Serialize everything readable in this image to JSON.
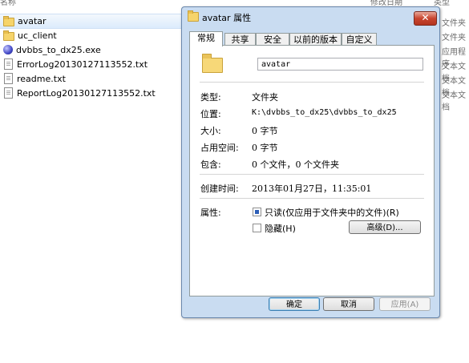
{
  "explorer": {
    "header": {
      "name_col": "名称",
      "date_col": "修改日期",
      "type_col": "类型"
    },
    "files": [
      {
        "name": "avatar",
        "icon": "folder-icon",
        "type": "文件夹",
        "selected": true
      },
      {
        "name": "uc_client",
        "icon": "folder-icon",
        "type": "文件夹"
      },
      {
        "name": "dvbbs_to_dx25.exe",
        "icon": "exe-icon",
        "type": "应用程序"
      },
      {
        "name": "ErrorLog20130127113552.txt",
        "icon": "text-file-icon",
        "type": "文本文档"
      },
      {
        "name": "readme.txt",
        "icon": "text-file-icon",
        "type": "文本文档"
      },
      {
        "name": "ReportLog20130127113552.txt",
        "icon": "text-file-icon",
        "type": "文本文档"
      }
    ]
  },
  "dialog": {
    "title": "avatar 属性",
    "close_label": "✕",
    "tabs": [
      "常规",
      "共享",
      "安全",
      "以前的版本",
      "自定义"
    ],
    "active_tab": "常规",
    "name_value": "avatar",
    "props": [
      {
        "label": "类型:",
        "value": "文件夹"
      },
      {
        "label": "位置:",
        "value": "K:\\dvbbs_to_dx25\\dvbbs_to_dx25"
      },
      {
        "label": "大小:",
        "value": "0 字节"
      },
      {
        "label": "占用空间:",
        "value": "0 字节"
      },
      {
        "label": "包含:",
        "value": "0 个文件，0 个文件夹"
      }
    ],
    "created": {
      "label": "创建时间:",
      "value": "2013年01月27日，11:35:01"
    },
    "attributes": {
      "label": "属性:",
      "readonly_label": "只读(仅应用于文件夹中的文件)(R)",
      "readonly_state": "indeterminate",
      "hidden_label": "隐藏(H)",
      "hidden_checked": false,
      "advanced_label": "高级(D)..."
    },
    "buttons": {
      "ok": "确定",
      "cancel": "取消",
      "apply": "应用(A)"
    }
  },
  "colors": {
    "dialog_frame": "#c9dcf1",
    "close_red": "#c8452f",
    "selection": "#dcebfc"
  }
}
